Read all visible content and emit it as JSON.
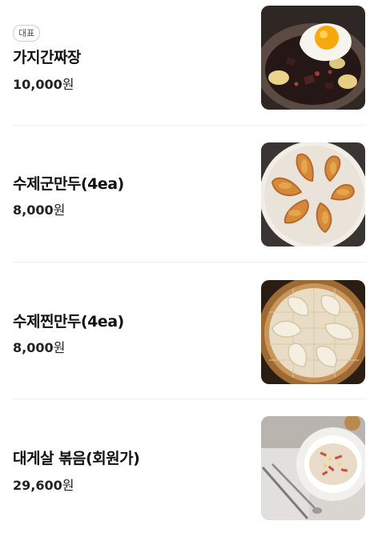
{
  "menu": {
    "items": [
      {
        "badge": "대표",
        "name": "가지간짜장",
        "price": "10,000",
        "currency": "원",
        "photo_icon": "jajang-with-egg-photo"
      },
      {
        "name": "수제군만두(4ea)",
        "price": "8,000",
        "currency": "원",
        "photo_icon": "fried-dumplings-photo"
      },
      {
        "name": "수제찐만두(4ea)",
        "price": "8,000",
        "currency": "원",
        "photo_icon": "steamed-dumplings-photo"
      },
      {
        "name": "대게살 볶음(회원가)",
        "price": "29,600",
        "currency": "원",
        "photo_icon": "crab-stir-fry-photo"
      }
    ]
  },
  "colors": {
    "text": "#111111",
    "divider": "#efefef",
    "badge_border": "#cfcfcf"
  }
}
